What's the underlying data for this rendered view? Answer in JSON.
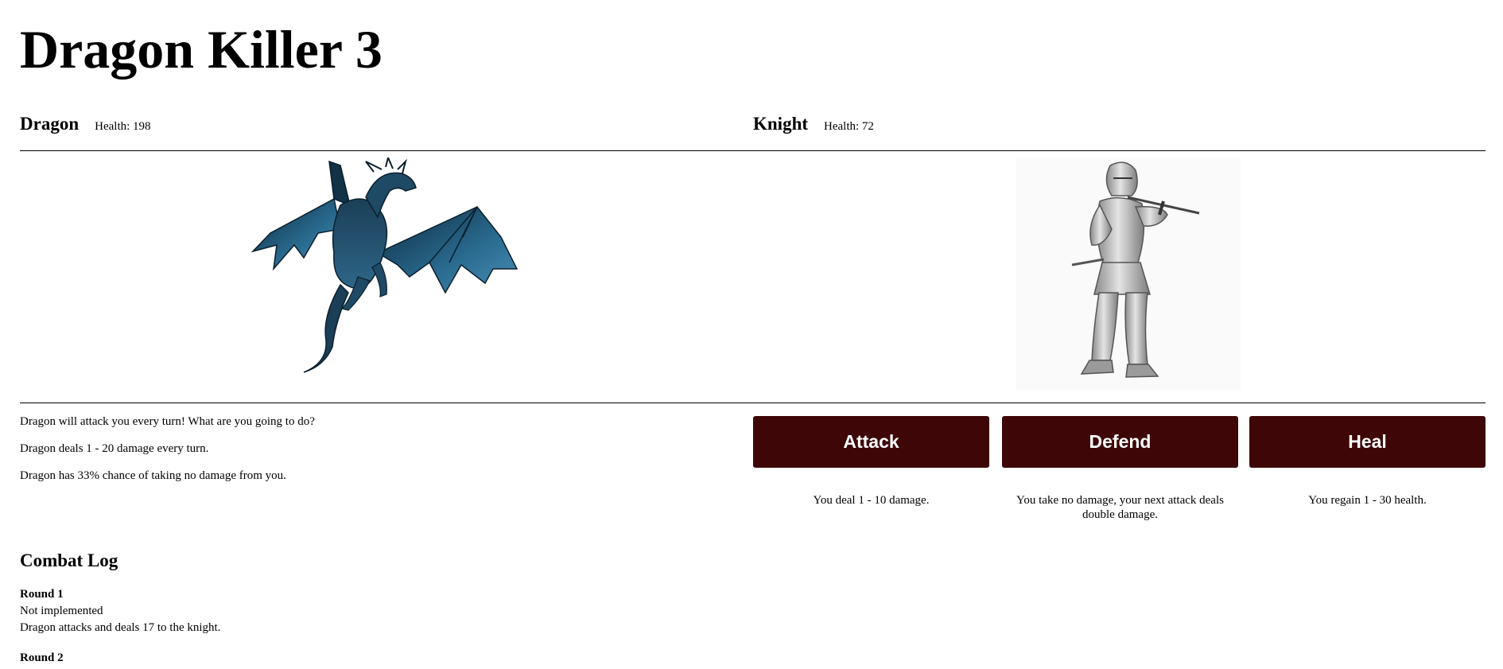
{
  "title": "Dragon Killer 3",
  "dragon": {
    "name": "Dragon",
    "health_text": "Health: 198",
    "health": 198
  },
  "knight": {
    "name": "Knight",
    "health_text": "Health: 72",
    "health": 72
  },
  "info": [
    "Dragon will attack you every turn! What are you going to do?",
    "Dragon deals 1 - 20 damage every turn.",
    "Dragon has 33% chance of taking no damage from you."
  ],
  "actions": [
    {
      "label": "Attack",
      "description": "You deal 1 - 10 damage."
    },
    {
      "label": "Defend",
      "description": "You take no damage, your next attack deals double damage."
    },
    {
      "label": "Heal",
      "description": "You regain 1 - 30 health."
    }
  ],
  "combat_log": {
    "heading": "Combat Log",
    "rounds": [
      {
        "title": "Round 1",
        "lines": [
          "Not implemented",
          "Dragon attacks and deals 17 to the knight."
        ]
      },
      {
        "title": "Round 2",
        "lines": []
      }
    ]
  },
  "colors": {
    "button_bg": "#3e0607",
    "button_text": "#ffffff",
    "dragon_body": "#2a5f80",
    "knight_armor": "#b8b8b8"
  },
  "images": {
    "dragon": "dragon-illustration",
    "knight": "armored-knight-illustration"
  }
}
